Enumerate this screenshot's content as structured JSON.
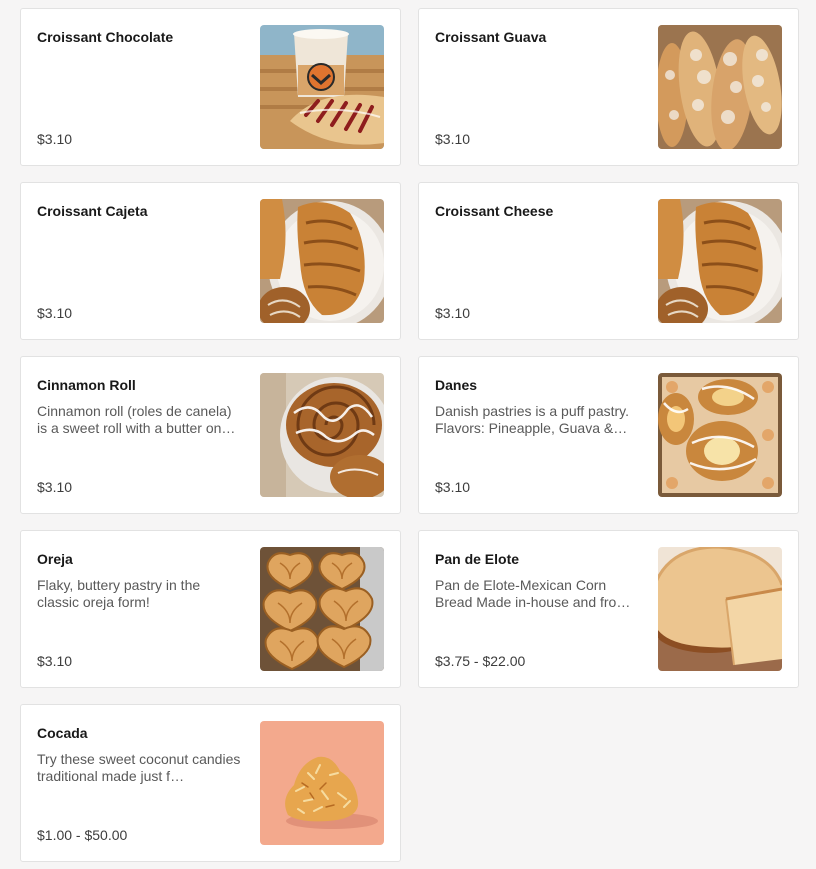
{
  "items": [
    {
      "name": "Croissant Chocolate",
      "description": "",
      "price": "$3.10",
      "image": "croissant-chocolate-photo"
    },
    {
      "name": "Croissant Guava",
      "description": "",
      "price": "$3.10",
      "image": "croissant-guava-photo"
    },
    {
      "name": "Croissant Cajeta",
      "description": "",
      "price": "$3.10",
      "image": "croissant-cajeta-photo"
    },
    {
      "name": "Croissant Cheese",
      "description": "",
      "price": "$3.10",
      "image": "croissant-cheese-photo"
    },
    {
      "name": "Cinnamon Roll",
      "description": "Cinnamon roll (roles de canela) is a sweet roll with a butter on…",
      "price": "$3.10",
      "image": "cinnamon-roll-photo"
    },
    {
      "name": "Danes",
      "description": "Danish pastries is a puff pastry. Flavors: Pineapple, Guava &…",
      "price": "$3.10",
      "image": "danes-photo"
    },
    {
      "name": "Oreja",
      "description": "Flaky, buttery pastry in the classic oreja form!",
      "price": "$3.10",
      "image": "oreja-photo"
    },
    {
      "name": "Pan de Elote",
      "description": "Pan de Elote-Mexican Corn Bread Made in-house and fro…",
      "price": "$3.75 - $22.00",
      "image": "pan-de-elote-photo"
    },
    {
      "name": "Cocada",
      "description": "Try these sweet coconut candies traditional made just f…",
      "price": "$1.00 - $50.00",
      "image": "cocada-photo"
    }
  ]
}
